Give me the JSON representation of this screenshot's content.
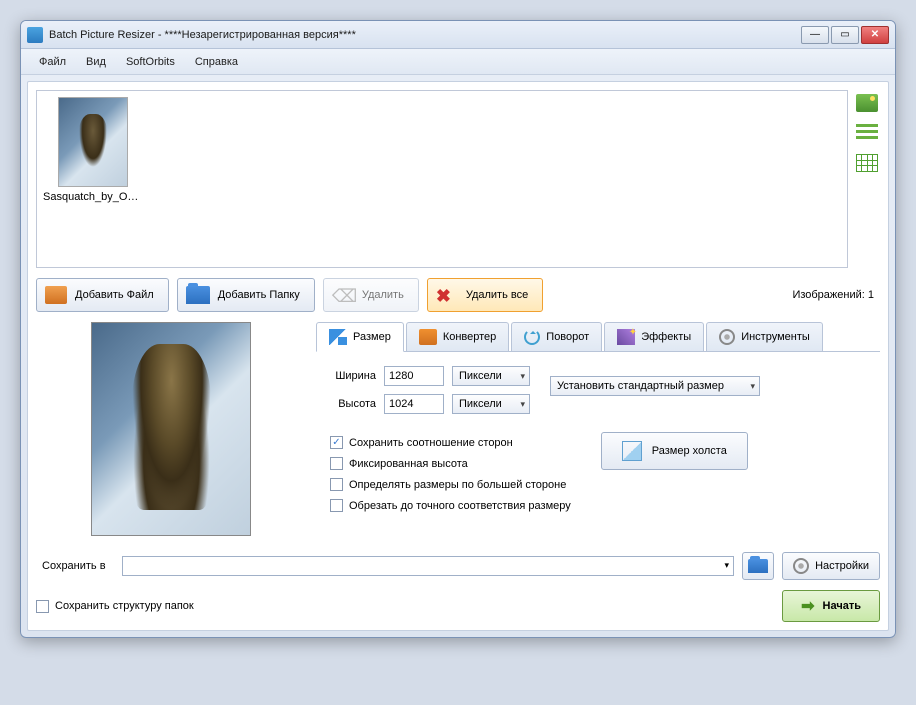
{
  "window": {
    "title": "Batch Picture Resizer - ****Незарегистрированная версия****"
  },
  "menu": {
    "file": "Файл",
    "view": "Вид",
    "softorbits": "SoftOrbits",
    "help": "Справка"
  },
  "thumb": {
    "filename": "Sasquatch_by_Okmer..."
  },
  "toolbar": {
    "add_file": "Добавить Файл",
    "add_folder": "Добавить Папку",
    "delete": "Удалить",
    "delete_all": "Удалить все",
    "count_label": "Изображений: 1"
  },
  "tabs": {
    "size": "Размер",
    "converter": "Конвертер",
    "rotate": "Поворот",
    "effects": "Эффекты",
    "tools": "Инструменты"
  },
  "size_panel": {
    "width_label": "Ширина",
    "width_value": "1280",
    "width_unit": "Пиксели",
    "height_label": "Высота",
    "height_value": "1024",
    "height_unit": "Пиксели",
    "preset_label": "Установить стандартный размер",
    "keep_ratio": "Сохранить соотношение сторон",
    "fixed_height": "Фиксированная высота",
    "by_larger_side": "Определять размеры по большей стороне",
    "crop_exact": "Обрезать до точного соответствия размеру",
    "canvas_size": "Размер холста"
  },
  "bottom": {
    "save_to": "Сохранить в",
    "settings": "Настройки",
    "keep_folders": "Сохранить структуру папок",
    "start": "Начать"
  }
}
